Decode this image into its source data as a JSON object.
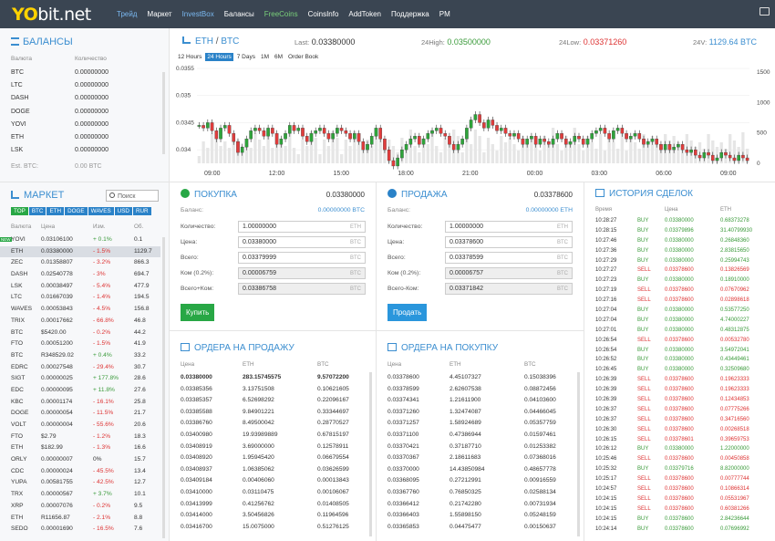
{
  "nav": {
    "logo_main": "YO",
    "logo_rest": "bit.net",
    "items": [
      [
        "Трейд",
        "blue"
      ],
      [
        "Маркет",
        ""
      ],
      [
        "InvestBox",
        "blue"
      ],
      [
        "Балансы",
        ""
      ],
      [
        "FreeCoins",
        "green"
      ],
      [
        "CoinsInfo",
        ""
      ],
      [
        "AddToken",
        ""
      ],
      [
        "Поддержка",
        ""
      ],
      [
        "PM",
        ""
      ]
    ]
  },
  "balances": {
    "title": "БАЛАНСЫ",
    "col_currency": "Валюта",
    "col_amount": "Количество",
    "rows": [
      [
        "BTC",
        "0.00000000"
      ],
      [
        "LTC",
        "0.00000000"
      ],
      [
        "DASH",
        "0.00000000"
      ],
      [
        "DOGE",
        "0.00000000"
      ],
      [
        "YOVI",
        "0.00000000"
      ],
      [
        "ETH",
        "0.00000000"
      ],
      [
        "LSK",
        "0.00000000"
      ]
    ],
    "est_label": "Est. BTC:",
    "est_value": "0.00 BTC"
  },
  "market": {
    "title": "МАРКЕТ",
    "search_placeholder": "Поиск",
    "tabs": [
      "TOP",
      "BTC",
      "ETH",
      "DOGE",
      "WAVES",
      "USD",
      "RUR"
    ],
    "col_currency": "Валюта",
    "col_price": "Цена",
    "col_change": "Изм.",
    "col_volume": "Об.",
    "new_badge": "NEW",
    "rows": [
      [
        "YOVI",
        "0.03106100",
        "+ 0.1%",
        "0.1",
        "green"
      ],
      [
        "ETH",
        "0.03380000",
        "- 1.5%",
        "1129.7",
        "red"
      ],
      [
        "ZEC",
        "0.01358807",
        "- 3.2%",
        "866.3",
        "red"
      ],
      [
        "DASH",
        "0.02540778",
        "- 3%",
        "694.7",
        "red"
      ],
      [
        "LSK",
        "0.00038497",
        "- 5.4%",
        "477.9",
        "red"
      ],
      [
        "LTC",
        "0.01667039",
        "- 1.4%",
        "194.5",
        "red"
      ],
      [
        "WAVES",
        "0.00053843",
        "- 4.5%",
        "156.8",
        "red"
      ],
      [
        "TRIX",
        "0.00017662",
        "- 66.8%",
        "46.8",
        "red"
      ],
      [
        "BTC",
        "$5420.00",
        "- 0.2%",
        "44.2",
        "red"
      ],
      [
        "FTO",
        "0.00051200",
        "- 1.5%",
        "41.9",
        "red"
      ],
      [
        "BTC",
        "R348529.02",
        "+ 0.4%",
        "33.2",
        "green"
      ],
      [
        "EDRC",
        "0.00027548",
        "- 29.4%",
        "30.7",
        "red"
      ],
      [
        "SIGT",
        "0.00000025",
        "+ 177.8%",
        "28.6",
        "green"
      ],
      [
        "EDC",
        "0.00000095",
        "+ 11.8%",
        "27.6",
        "green"
      ],
      [
        "KBC",
        "0.00001174",
        "- 16.1%",
        "25.8",
        "red"
      ],
      [
        "DOGE",
        "0.00000054",
        "- 11.5%",
        "21.7",
        "red"
      ],
      [
        "VOLT",
        "0.00000004",
        "- 55.6%",
        "20.6",
        "red"
      ],
      [
        "FTO",
        "$2.79",
        "- 1.2%",
        "18.3",
        "red"
      ],
      [
        "ETH",
        "$182.99",
        "- 1.3%",
        "16.6",
        "red"
      ],
      [
        "ORLY",
        "0.00000007",
        "0%",
        "15.7",
        ""
      ],
      [
        "CDC",
        "0.00000024",
        "- 45.5%",
        "13.4",
        "red"
      ],
      [
        "YUPA",
        "0.00581755",
        "- 42.5%",
        "12.7",
        "red"
      ],
      [
        "TRX",
        "0.00000567",
        "+ 3.7%",
        "10.1",
        "green"
      ],
      [
        "XRP",
        "0.00007076",
        "- 0.2%",
        "9.5",
        "red"
      ],
      [
        "ETH",
        "R11656.87",
        "- 2.1%",
        "8.8",
        "red"
      ],
      [
        "SEDO",
        "0.00001690",
        "- 16.5%",
        "7.6",
        "red"
      ]
    ]
  },
  "chart": {
    "pair_a": "ETH",
    "pair_sep": " / ",
    "pair_b": "BTC",
    "last_label": "Last:",
    "last": "0.03380000",
    "high_label": "24High:",
    "high": "0.03500000",
    "low_label": "24Low:",
    "low": "0.03371260",
    "vol_label": "24V:",
    "vol": "1129.64 BTC",
    "periods": [
      "12 Hours",
      "24 Hours",
      "7 Days",
      "1M",
      "6M",
      "Order Book"
    ],
    "active_period": "24 Hours"
  },
  "chart_data": {
    "type": "candlestick",
    "y_ticks": [
      "0.0355",
      "0.035",
      "0.0345",
      "0.034"
    ],
    "vol_ticks": [
      "1500",
      "1000",
      "500",
      "0"
    ],
    "x_ticks": [
      "09:00",
      "12:00",
      "15:00",
      "18:00",
      "21:00",
      "00:00",
      "03:00",
      "06:00",
      "09:00"
    ],
    "closes": [
      0.03445,
      0.0344,
      0.0345,
      0.03435,
      0.0342,
      0.0344,
      0.03445,
      0.0343,
      0.03415,
      0.03395,
      0.03405,
      0.0342,
      0.03435,
      0.0344,
      0.03435,
      0.03425,
      0.0344,
      0.0343,
      0.0341,
      0.0342,
      0.0343,
      0.03445,
      0.03435,
      0.0344,
      0.03425,
      0.03415,
      0.0343,
      0.03435,
      0.0344,
      0.0343,
      0.0342,
      0.0343,
      0.0344,
      0.03435,
      0.0343,
      0.0342,
      0.0343,
      0.03415,
      0.034,
      0.0341,
      0.03425,
      0.0344,
      0.0342,
      0.034,
      0.0338,
      0.0337,
      0.03385,
      0.034,
      0.0341,
      0.0342,
      0.03425,
      0.0341,
      0.0342,
      0.0343,
      0.03435,
      0.0344,
      0.0343,
      0.03425,
      0.0341,
      0.034,
      0.0341,
      0.0342,
      0.0344,
      0.03455,
      0.03465,
      0.0345,
      0.0344,
      0.03455,
      0.03445,
      0.03435,
      0.0344,
      0.0343,
      0.03425,
      0.0343,
      0.0342,
      0.0341,
      0.0342,
      0.03425,
      0.0341,
      0.0342,
      0.03415,
      0.0341,
      0.0342,
      0.0343,
      0.0342,
      0.0341,
      0.03415,
      0.03425,
      0.0342,
      0.0341,
      0.0342,
      0.0343,
      0.03435,
      0.0344,
      0.0343,
      0.0342,
      0.03435,
      0.0344,
      0.0343,
      0.0342,
      0.03425,
      0.0343,
      0.0342,
      0.0341,
      0.03415,
      0.0342,
      0.0341,
      0.034,
      0.0341,
      0.034,
      0.03405,
      0.0341,
      0.034,
      0.03395,
      0.034,
      0.0339,
      0.03385,
      0.03395,
      0.0339,
      0.0338,
      0.03385,
      0.03395,
      0.0339,
      0.03385,
      0.0338,
      0.0339,
      0.03385,
      0.0338
    ]
  },
  "buy": {
    "title": "ПОКУПКА",
    "price": "0.03380000",
    "balance_label": "Баланс:",
    "balance": "0.00000000 BTC",
    "qty_label": "Количество:",
    "qty": "1.00000000",
    "qty_unit": "ETH",
    "price_label": "Цена:",
    "price_val": "0.03380000",
    "price_unit": "BTC",
    "total_label": "Всего:",
    "total": "0.03379999",
    "total_unit": "BTC",
    "fee_label": "Ком (0.2%):",
    "fee": "0.00006759",
    "fee_unit": "BTC",
    "totalfee_label": "Всего+Ком:",
    "totalfee": "0.03386758",
    "totalfee_unit": "BTC",
    "button": "Купить"
  },
  "sell": {
    "title": "ПРОДАЖА",
    "price": "0.03378600",
    "balance_label": "Баланс:",
    "balance": "0.00000000 ETH",
    "qty_label": "Количество:",
    "qty": "1.00000000",
    "qty_unit": "ETH",
    "price_label": "Цена:",
    "price_val": "0.03378600",
    "price_unit": "BTC",
    "total_label": "Всего:",
    "total": "0.03378599",
    "total_unit": "BTC",
    "fee_label": "Ком (0.2%):",
    "fee": "0.00006757",
    "fee_unit": "BTC",
    "totalfee_label": "Всего-Ком:",
    "totalfee": "0.03371842",
    "totalfee_unit": "BTC",
    "button": "Продать"
  },
  "sell_orders": {
    "title": "ОРДЕРА НА ПРОДАЖУ",
    "col_price": "Цена",
    "col_eth": "ETH",
    "col_btc": "BTC",
    "rows": [
      [
        "0.03380000",
        "283.15745575",
        "9.57072200"
      ],
      [
        "0.03385356",
        "3.13751508",
        "0.10621605"
      ],
      [
        "0.03385357",
        "6.52698292",
        "0.22096167"
      ],
      [
        "0.03385588",
        "9.84901221",
        "0.33344697"
      ],
      [
        "0.03386760",
        "8.49500042",
        "0.28770527"
      ],
      [
        "0.03400980",
        "19.93989889",
        "0.67815197"
      ],
      [
        "0.03408919",
        "3.69000000",
        "0.12578911"
      ],
      [
        "0.03408920",
        "1.95945420",
        "0.06679554"
      ],
      [
        "0.03408937",
        "1.06385062",
        "0.03626599"
      ],
      [
        "0.03409184",
        "0.00406060",
        "0.00013843"
      ],
      [
        "0.03410000",
        "0.03110475",
        "0.00106067"
      ],
      [
        "0.03413999",
        "0.41256762",
        "0.01408505"
      ],
      [
        "0.03414000",
        "3.50456826",
        "0.11964596"
      ],
      [
        "0.03416700",
        "15.0075000",
        "0.51276125"
      ]
    ]
  },
  "buy_orders": {
    "title": "ОРДЕРА НА ПОКУПКУ",
    "col_price": "Цена",
    "col_eth": "ETH",
    "col_btc": "BTC",
    "rows": [
      [
        "0.03378600",
        "4.45107327",
        "0.15038396"
      ],
      [
        "0.03378599",
        "2.62607538",
        "0.08872456"
      ],
      [
        "0.03374341",
        "1.21611900",
        "0.04103600"
      ],
      [
        "0.03371260",
        "1.32474087",
        "0.04466045"
      ],
      [
        "0.03371257",
        "1.58924689",
        "0.05357759"
      ],
      [
        "0.03371100",
        "0.47386944",
        "0.01597461"
      ],
      [
        "0.03370421",
        "0.37187710",
        "0.01253382"
      ],
      [
        "0.03370367",
        "2.18611683",
        "0.07368016"
      ],
      [
        "0.03370000",
        "14.43850984",
        "0.48657778"
      ],
      [
        "0.03368095",
        "0.27212991",
        "0.00916559"
      ],
      [
        "0.03367760",
        "0.76850325",
        "0.02588134"
      ],
      [
        "0.03366412",
        "0.21742280",
        "0.00731934"
      ],
      [
        "0.03366403",
        "1.55898150",
        "0.05248159"
      ],
      [
        "0.03365853",
        "0.04475477",
        "0.00150637"
      ]
    ]
  },
  "history": {
    "title": "ИСТОРИЯ СДЕЛОК",
    "col_time": "Время",
    "col_price": "Цена",
    "col_eth": "ETH",
    "rows": [
      [
        "10:28:27",
        "BUY",
        "0.03380000",
        "0.68373278"
      ],
      [
        "10:28:15",
        "BUY",
        "0.03379896",
        "31.40799930"
      ],
      [
        "10:27:46",
        "BUY",
        "0.03380000",
        "0.26848360"
      ],
      [
        "10:27:36",
        "BUY",
        "0.03380000",
        "2.83815650"
      ],
      [
        "10:27:29",
        "BUY",
        "0.03380000",
        "0.25994743"
      ],
      [
        "10:27:27",
        "SELL",
        "0.03378600",
        "0.13826569"
      ],
      [
        "10:27:23",
        "BUY",
        "0.03380000",
        "0.18910000"
      ],
      [
        "10:27:19",
        "SELL",
        "0.03378600",
        "0.07670962"
      ],
      [
        "10:27:16",
        "SELL",
        "0.03378600",
        "0.02898618"
      ],
      [
        "10:27:04",
        "BUY",
        "0.03380000",
        "0.53577250"
      ],
      [
        "10:27:04",
        "BUY",
        "0.03380000",
        "4.74000227"
      ],
      [
        "10:27:01",
        "BUY",
        "0.03380000",
        "0.48312875"
      ],
      [
        "10:26:54",
        "SELL",
        "0.03378600",
        "0.00532780"
      ],
      [
        "10:26:54",
        "BUY",
        "0.03380000",
        "3.54972041"
      ],
      [
        "10:26:52",
        "BUY",
        "0.03380000",
        "0.43449461"
      ],
      [
        "10:26:45",
        "BUY",
        "0.03380000",
        "0.32509680"
      ],
      [
        "10:26:39",
        "SELL",
        "0.03378600",
        "0.19623333"
      ],
      [
        "10:26:39",
        "SELL",
        "0.03378600",
        "0.19623333"
      ],
      [
        "10:26:39",
        "SELL",
        "0.03378600",
        "0.12434853"
      ],
      [
        "10:26:37",
        "SELL",
        "0.03378600",
        "0.07775266"
      ],
      [
        "10:26:37",
        "SELL",
        "0.03378600",
        "0.34716560"
      ],
      [
        "10:26:30",
        "SELL",
        "0.03378600",
        "0.00268518"
      ],
      [
        "10:26:15",
        "SELL",
        "0.03378601",
        "0.39659753"
      ],
      [
        "10:26:12",
        "BUY",
        "0.03380000",
        "1.22000000"
      ],
      [
        "10:25:46",
        "SELL",
        "0.03378600",
        "0.00450858"
      ],
      [
        "10:25:32",
        "BUY",
        "0.03379716",
        "8.82000000"
      ],
      [
        "10:25:17",
        "SELL",
        "0.03378600",
        "0.00777744"
      ],
      [
        "10:24:57",
        "SELL",
        "0.03378600",
        "0.10866314"
      ],
      [
        "10:24:15",
        "SELL",
        "0.03378600",
        "0.05531967"
      ],
      [
        "10:24:15",
        "SELL",
        "0.03378600",
        "0.60381266"
      ],
      [
        "10:24:15",
        "BUY",
        "0.03378600",
        "2.84236644"
      ],
      [
        "10:24:14",
        "BUY",
        "0.03378600",
        "0.07696992"
      ]
    ]
  }
}
